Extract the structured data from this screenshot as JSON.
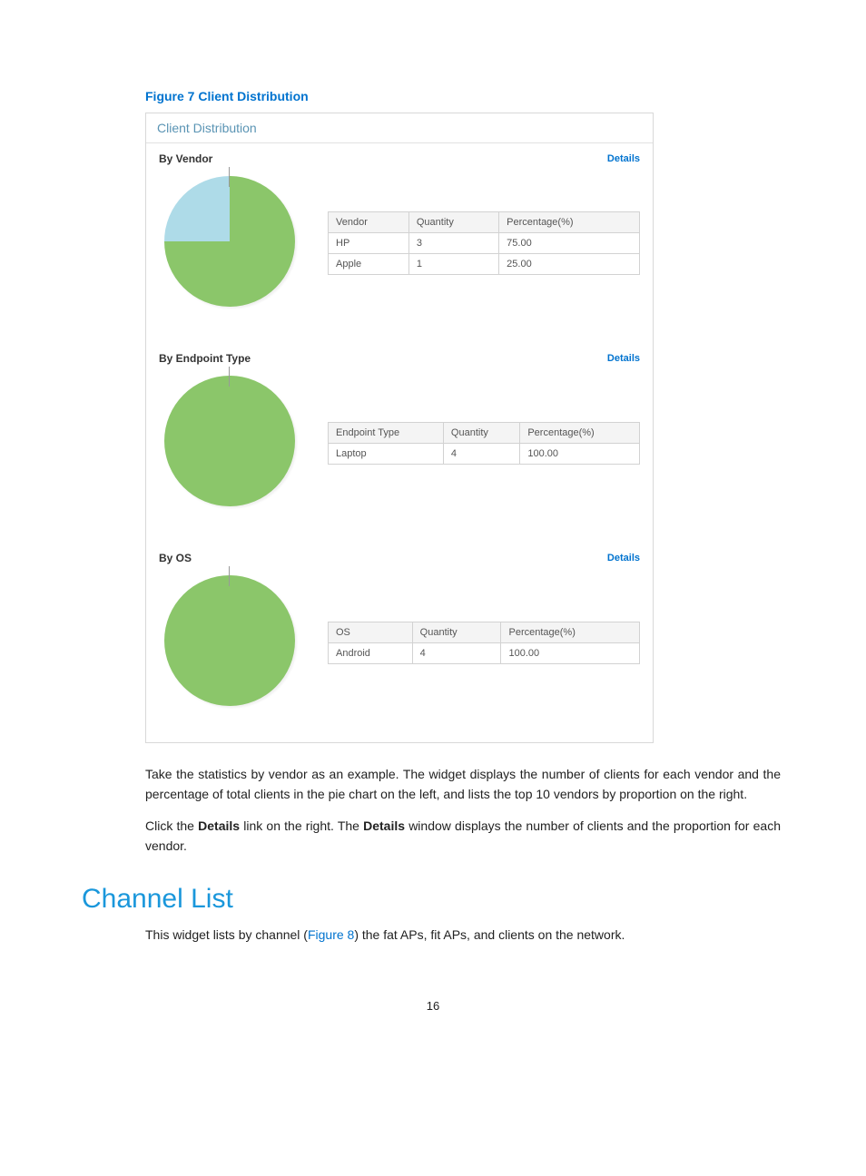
{
  "figure_caption": "Figure 7 Client Distribution",
  "widget_title": "Client Distribution",
  "details_label": "Details",
  "headers": {
    "quantity": "Quantity",
    "percentage": "Percentage(%)"
  },
  "sections": [
    {
      "title": "By Vendor",
      "col0": "Vendor",
      "rows": [
        {
          "c0": "HP",
          "c1": "3",
          "c2": "75.00"
        },
        {
          "c0": "Apple",
          "c1": "1",
          "c2": "25.00"
        }
      ]
    },
    {
      "title": "By Endpoint Type",
      "col0": "Endpoint Type",
      "rows": [
        {
          "c0": "Laptop",
          "c1": "4",
          "c2": "100.00"
        }
      ]
    },
    {
      "title": "By OS",
      "col0": "OS",
      "rows": [
        {
          "c0": "Android",
          "c1": "4",
          "c2": "100.00"
        }
      ]
    }
  ],
  "chart_data": [
    {
      "type": "pie",
      "title": "By Vendor",
      "series": [
        {
          "name": "HP",
          "value": 3,
          "percentage": 75.0,
          "color": "#8bc66a"
        },
        {
          "name": "Apple",
          "value": 1,
          "percentage": 25.0,
          "color": "#aedbe8"
        }
      ]
    },
    {
      "type": "pie",
      "title": "By Endpoint Type",
      "series": [
        {
          "name": "Laptop",
          "value": 4,
          "percentage": 100.0,
          "color": "#8bc66a"
        }
      ]
    },
    {
      "type": "pie",
      "title": "By OS",
      "series": [
        {
          "name": "Android",
          "value": 4,
          "percentage": 100.0,
          "color": "#8bc66a"
        }
      ]
    }
  ],
  "para1_pre": "Take the statistics by vendor as an example. The widget displays the number of clients for each vendor and the percentage of total clients in the pie chart on the left, and lists the top 10 vendors by proportion on the right.",
  "para2_a": "Click the ",
  "para2_b": "Details",
  "para2_c": " link on the right. The ",
  "para2_d": "Details",
  "para2_e": " window displays the number of clients and the proportion for each vendor.",
  "channel_heading": "Channel List",
  "para3_a": "This widget lists by channel (",
  "para3_ref": "Figure 8",
  "para3_b": ") the fat APs, fit APs, and clients on the network.",
  "page_number": "16"
}
